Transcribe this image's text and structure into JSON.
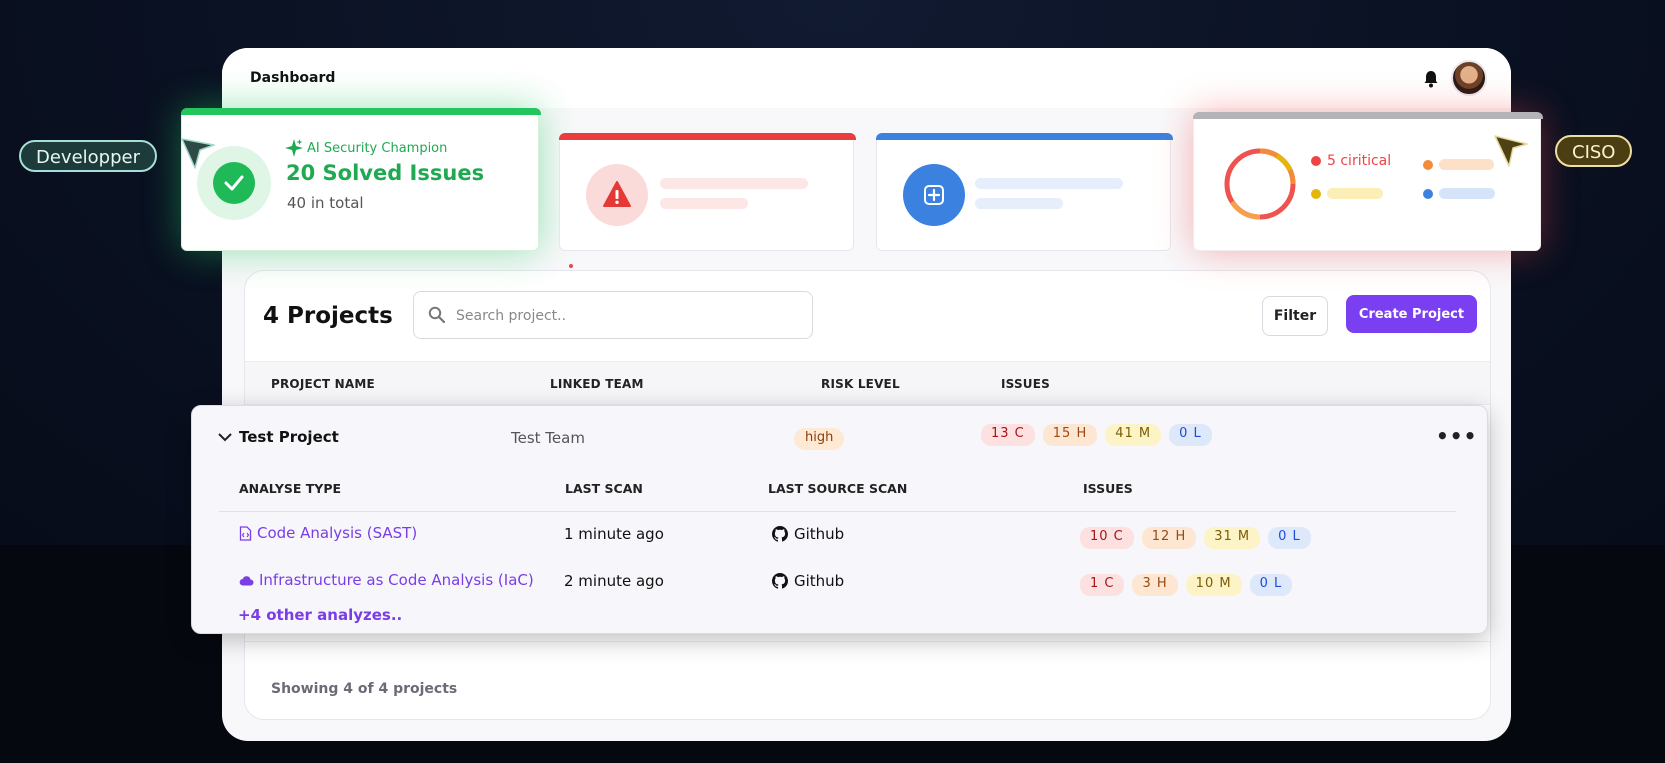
{
  "colors": {
    "accent": "#7b3ff2",
    "success": "#1fba57",
    "danger": "#ea3d3d",
    "info": "#3b82e0"
  },
  "header": {
    "title": "Dashboard",
    "bell_icon": "bell-icon",
    "avatar_icon": "user-avatar"
  },
  "persona_tags": {
    "developer": "Developper",
    "ciso": "CISO"
  },
  "stat_cards": {
    "champion": {
      "label": "AI Security Champion",
      "headline": "20 Solved Issues",
      "sub": "40 in total",
      "icon": "check-icon"
    },
    "alerts": {
      "icon": "warning-icon"
    },
    "create": {
      "icon": "plus-icon"
    },
    "risk": {
      "critical_label": "5 ciritical"
    }
  },
  "projects": {
    "title": "4 Projects",
    "search_placeholder": "Search project..",
    "filter_label": "Filter",
    "create_label": "Create Project",
    "columns": {
      "name": "PROJECT NAME",
      "team": "LINKED TEAM",
      "risk": "RISK LEVEL",
      "issues": "ISSUES"
    },
    "footer": "Showing 4 of 4 projects"
  },
  "expanded_project": {
    "name": "Test Project",
    "team": "Test Team",
    "risk": "high",
    "issues": {
      "c": "13 C",
      "h": "15 H",
      "m": "41 M",
      "l": "0 L"
    },
    "more_icon": "more-horizontal-icon",
    "sub_columns": {
      "type": "ANALYSE TYPE",
      "last_scan": "LAST SCAN",
      "source": "LAST SOURCE SCAN",
      "issues": "ISSUES"
    },
    "analyses": [
      {
        "name": "Code Analysis (SAST)",
        "icon": "code-file-icon",
        "last_scan": "1 minute ago",
        "source": "Github",
        "issues": {
          "c": "10 C",
          "h": "12 H",
          "m": "31 M",
          "l": "0 L"
        }
      },
      {
        "name": "Infrastructure as Code Analysis (IaC)",
        "icon": "cloud-icon",
        "last_scan": "2 minute ago",
        "source": "Github",
        "issues": {
          "c": "1 C",
          "h": "3 H",
          "m": "10 M",
          "l": "0 L"
        }
      }
    ],
    "other_link": "+4 other analyzes.."
  }
}
